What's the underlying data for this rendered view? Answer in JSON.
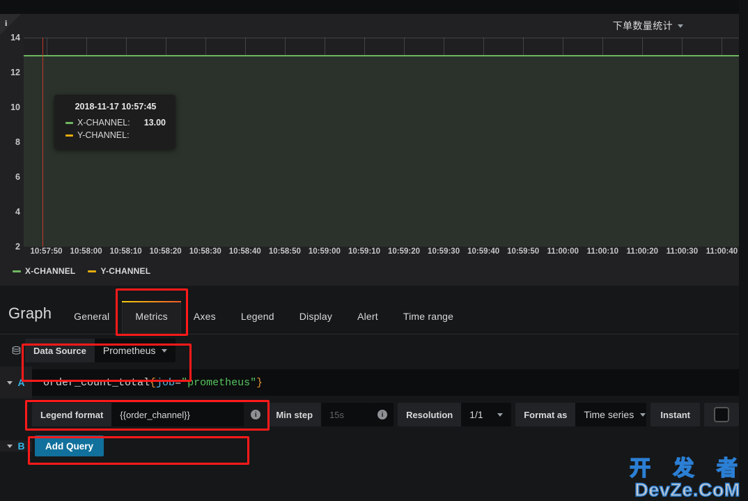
{
  "panel": {
    "title": "下单数量统计",
    "info_icon": "i",
    "caret_icon": "chevron-down-icon"
  },
  "chart_data": {
    "type": "line",
    "title": "下单数量统计",
    "xlabel": "",
    "ylabel": "",
    "ylim": [
      2,
      14
    ],
    "yticks": [
      14,
      12,
      10,
      8,
      6,
      4,
      2
    ],
    "xticks": [
      "10:57:50",
      "10:58:00",
      "10:58:10",
      "10:58:20",
      "10:58:30",
      "10:58:40",
      "10:58:50",
      "10:59:00",
      "10:59:10",
      "10:59:20",
      "10:59:30",
      "10:59:40",
      "10:59:50",
      "11:00:00",
      "11:00:10",
      "11:00:20",
      "11:00:30",
      "11:00:40"
    ],
    "grid": true,
    "legend_position": "bottom-left",
    "series": [
      {
        "name": "X-CHANNEL",
        "color": "#6fb760",
        "constant_value": 13.0,
        "filled": true
      },
      {
        "name": "Y-CHANNEL",
        "color": "#e5ac0e",
        "constant_value": null,
        "filled": false
      }
    ],
    "crosshair_time": "2018-11-17 10:57:45"
  },
  "tooltip": {
    "time": "2018-11-17 10:57:45",
    "rows": [
      {
        "label": "X-CHANNEL:",
        "value": "13.00",
        "color": "#6fb760"
      },
      {
        "label": "Y-CHANNEL:",
        "value": "",
        "color": "#e5ac0e"
      }
    ]
  },
  "legend": [
    {
      "label": "X-CHANNEL",
      "color": "#6fb760"
    },
    {
      "label": "Y-CHANNEL",
      "color": "#e5ac0e"
    }
  ],
  "editor": {
    "heading": "Graph",
    "tabs": [
      {
        "label": "General",
        "active": false
      },
      {
        "label": "Metrics",
        "active": true
      },
      {
        "label": "Axes",
        "active": false
      },
      {
        "label": "Legend",
        "active": false
      },
      {
        "label": "Display",
        "active": false
      },
      {
        "label": "Alert",
        "active": false
      },
      {
        "label": "Time range",
        "active": false
      }
    ],
    "datasource": {
      "icon": "database-icon",
      "label": "Data Source",
      "value": "Prometheus"
    },
    "queries": [
      {
        "letter": "A",
        "expression_parts": [
          {
            "text": "order_count_total",
            "token": "metric"
          },
          {
            "text": "{",
            "token": "brace"
          },
          {
            "text": "job",
            "token": "key"
          },
          {
            "text": "=",
            "token": "eq"
          },
          {
            "text": "\"prometheus\"",
            "token": "str"
          },
          {
            "text": "}",
            "token": "brace"
          }
        ],
        "expression_plain": "order_count_total{job=\"prometheus\"}"
      },
      {
        "letter": "B"
      }
    ],
    "options": {
      "legend_format_label": "Legend format",
      "legend_format_value": "{{order_channel}}",
      "min_step_label": "Min step",
      "min_step_placeholder": "15s",
      "resolution_label": "Resolution",
      "resolution_value": "1/1",
      "format_as_label": "Format as",
      "format_as_value": "Time series",
      "instant_label": "Instant",
      "instant_checked": false,
      "info_icon": "info-icon"
    },
    "add_query_label": "Add Query"
  },
  "watermark": {
    "line1": "开 发 者",
    "line2": "DevZe.CoM"
  },
  "colors": {
    "accent_green": "#6fb760",
    "accent_yellow": "#e5ac0e",
    "annotation_red": "#ff1a1a",
    "button_blue": "#11709c",
    "tab_active_gradient_start": "#f2cc0c",
    "tab_active_gradient_end": "#f05a28"
  }
}
